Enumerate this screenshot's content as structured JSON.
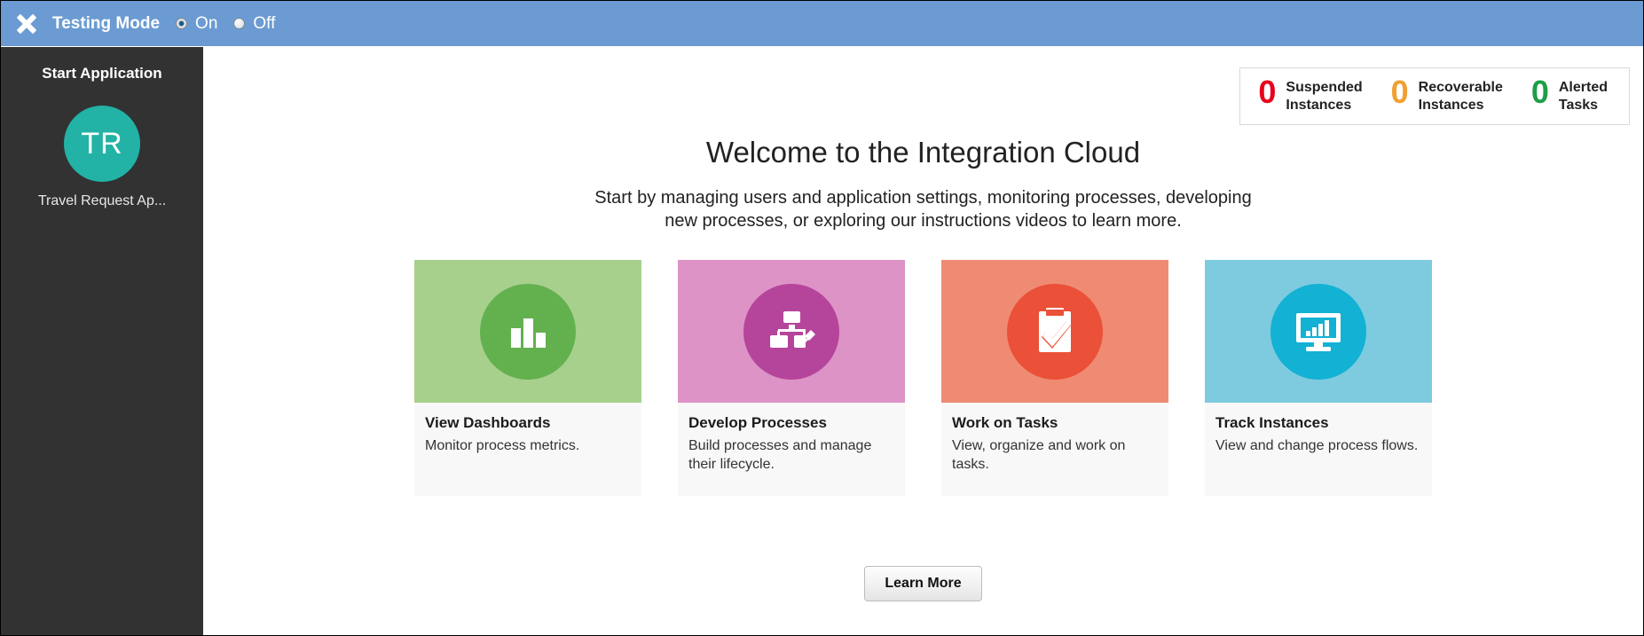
{
  "topbar": {
    "close_icon": "close-x-icon",
    "title": "Testing Mode",
    "options": [
      {
        "label": "On",
        "selected": true
      },
      {
        "label": "Off",
        "selected": false
      }
    ]
  },
  "sidebar": {
    "title": "Start Application",
    "app": {
      "initials": "TR",
      "name": "Travel Request Ap...",
      "avatar_color": "#22b2a6"
    }
  },
  "status": {
    "items": [
      {
        "count": "0",
        "label_line1": "Suspended",
        "label_line2": "Instances",
        "color": "#e8001c"
      },
      {
        "count": "0",
        "label_line1": "Recoverable",
        "label_line2": "Instances",
        "color": "#f0a030"
      },
      {
        "count": "0",
        "label_line1": "Alerted",
        "label_line2": "Tasks",
        "color": "#1e9e48"
      }
    ]
  },
  "main": {
    "welcome_title": "Welcome to the Integration Cloud",
    "welcome_subtitle": "Start by managing users and application settings, monitoring processes, developing new processes, or exploring our instructions videos to learn more.",
    "learn_more_label": "Learn More",
    "cards": [
      {
        "title": "View Dashboards",
        "description": "Monitor process metrics.",
        "banner_color": "#a8d08d",
        "circle_color": "#63b04f",
        "icon": "bar-chart-icon"
      },
      {
        "title": "Develop Processes",
        "description": "Build processes and manage their lifecycle.",
        "banner_color": "#dd93c6",
        "circle_color": "#b5459b",
        "icon": "process-edit-icon"
      },
      {
        "title": "Work on Tasks",
        "description": "View, organize and work on tasks.",
        "banner_color": "#ef8b72",
        "circle_color": "#ea5138",
        "icon": "clipboard-check-icon"
      },
      {
        "title": "Track Instances",
        "description": "View and change process flows.",
        "banner_color": "#7ecbe0",
        "circle_color": "#13b1d4",
        "icon": "monitor-chart-icon"
      }
    ]
  }
}
